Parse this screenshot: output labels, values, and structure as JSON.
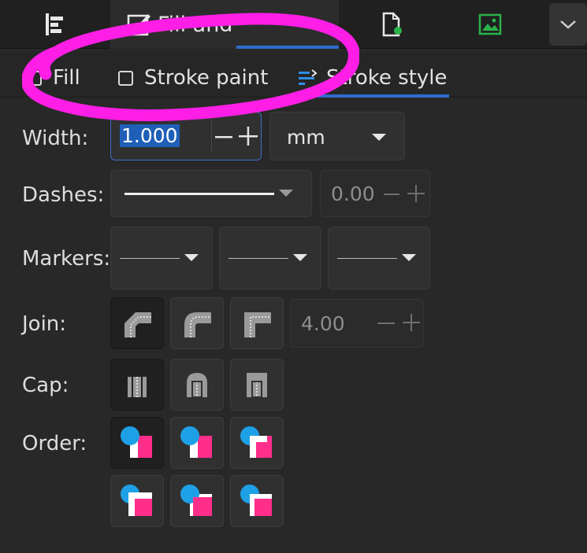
{
  "dock": {
    "tabs": [
      {
        "icon": "align-icon"
      },
      {
        "icon": "fill-stroke-icon",
        "label": "Fill and"
      },
      {
        "icon": "export-icon"
      },
      {
        "icon": "image-icon"
      }
    ],
    "menu_icon": "chevron-down-icon"
  },
  "subtabs": {
    "fill": "Fill",
    "stroke_paint": "Stroke paint",
    "stroke_style": "Stroke style"
  },
  "labels": {
    "width": "Width:",
    "dashes": "Dashes:",
    "markers": "Markers:",
    "join": "Join:",
    "cap": "Cap:",
    "order": "Order:"
  },
  "width": {
    "value": "1.000",
    "unit": "mm"
  },
  "dashes": {
    "offset": "0.00"
  },
  "join": {
    "miter_limit": "4.00"
  },
  "colors": {
    "accent": "#2e6bcf",
    "annotation": "#ff1ee6",
    "order_circle": "#1ea0e6",
    "order_square": "#ff2e8a"
  }
}
